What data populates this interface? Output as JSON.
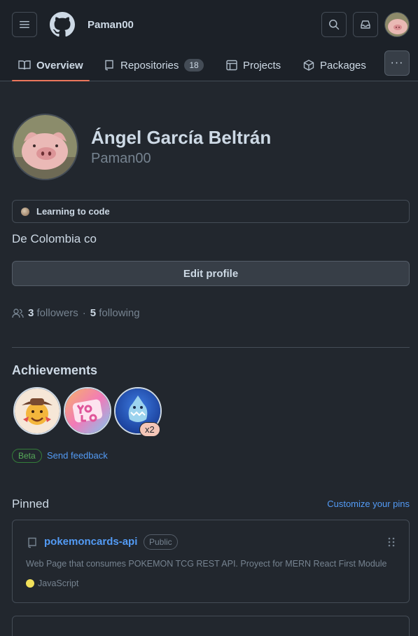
{
  "header": {
    "username": "Paman00",
    "tabs": [
      {
        "label": "Overview"
      },
      {
        "label": "Repositories",
        "count": "18"
      },
      {
        "label": "Projects"
      },
      {
        "label": "Packages"
      }
    ],
    "more_label": "···"
  },
  "profile": {
    "name": "Ángel García Beltrán",
    "login": "Paman00",
    "status": "Learning to code",
    "bio": "De Colombia co",
    "edit_label": "Edit profile",
    "followers_count": "3",
    "followers_label": "followers",
    "separator": "·",
    "following_count": "5",
    "following_label": "following"
  },
  "achievements": {
    "title": "Achievements",
    "badges": [
      {
        "icon": "cowboy-badge-icon"
      },
      {
        "icon": "yolo-badge-icon"
      },
      {
        "icon": "shark-badge-icon",
        "count": "x2"
      }
    ],
    "beta_label": "Beta",
    "feedback_label": "Send feedback"
  },
  "pinned": {
    "title": "Pinned",
    "customize_label": "Customize your pins",
    "repos": [
      {
        "name": "pokemoncards-api",
        "visibility": "Public",
        "description": "Web Page that consumes POKEMON TCG REST API. Proyect for MERN React First Module",
        "language": "JavaScript",
        "language_color": "#f1e05a"
      }
    ]
  },
  "colors": {
    "background": "#22272e",
    "header": "#1c2128",
    "accent": "#539bf5",
    "tab_underline": "#ec775c"
  }
}
